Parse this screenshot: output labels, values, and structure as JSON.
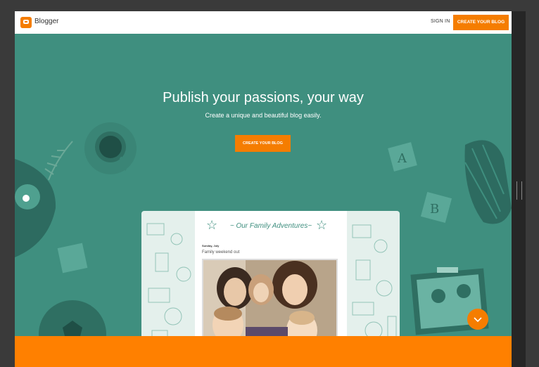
{
  "header": {
    "brand": "Blogger",
    "signin": "SIGN IN",
    "create_top": "CREATE YOUR BLOG"
  },
  "hero": {
    "title": "Publish your passions, your way",
    "subtitle": "Create a unique and beautiful blog easily.",
    "cta": "CREATE YOUR BLOG"
  },
  "mock_blog": {
    "title": "~ Our Family Adventures~",
    "date": "Sunday, July",
    "post_title": "Family weekend out"
  },
  "colors": {
    "teal": "#3f8f7f",
    "accent_orange": "#f57d00",
    "bottom_orange": "#ff8000"
  },
  "icons": {
    "logo": "blogger-logo-icon",
    "star": "star-outline-icon",
    "scroll": "chevron-down-icon"
  }
}
